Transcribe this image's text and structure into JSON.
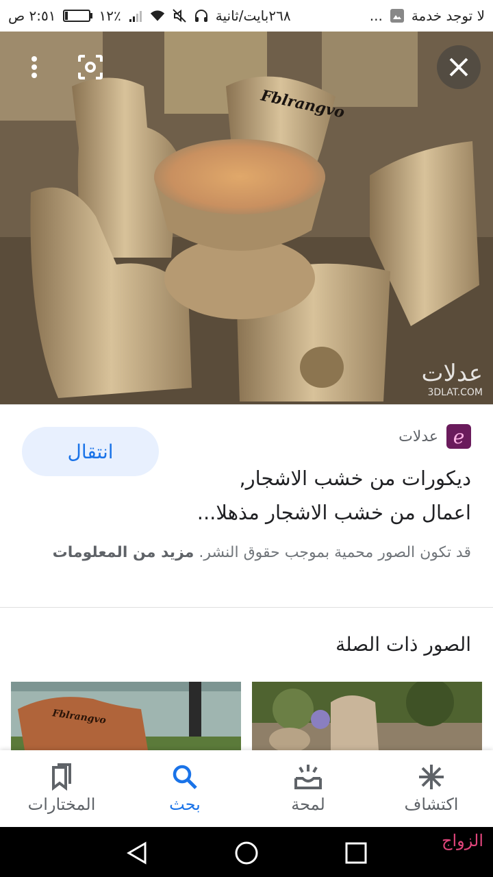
{
  "status_bar": {
    "time": "٢:٥١ ص",
    "battery_percent": "١٢٪",
    "data_speed": "٢٦٨بايت/ثانية",
    "carrier": "لا توجد خدمة",
    "more": "..."
  },
  "hero": {
    "watermark_brand": "عدلات",
    "watermark_domain": "3DLAT.COM",
    "carved_text": "Fblrangvo"
  },
  "result": {
    "source_name": "عدلات",
    "favicon_letter": "e",
    "visit_label": "انتقال",
    "title_line1": "ديكورات من خشب الاشجار,",
    "title_line2": "اعمال من خشب الاشجار مذهلا...",
    "copyright_text": "قد تكون الصور محمية بموجب حقوق النشر.",
    "more_info": "مزيد من المعلومات"
  },
  "related": {
    "title": "الصور ذات الصلة",
    "thumb_carved_text": "Fblrangvo"
  },
  "bottom_nav": {
    "discover": "اكتشاف",
    "glance": "لمحة",
    "search": "بحث",
    "favorites": "المختارات"
  },
  "system_watermark": "الزواج",
  "colors": {
    "accent": "#1a73e8",
    "visit_bg": "#e8f0fe",
    "favicon_bg": "#6a1b5c"
  }
}
